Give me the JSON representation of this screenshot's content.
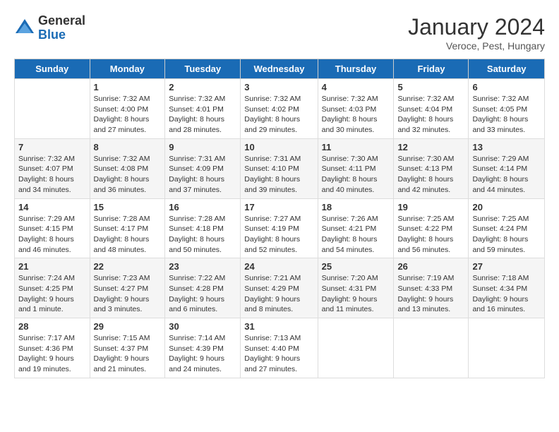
{
  "logo": {
    "general": "General",
    "blue": "Blue"
  },
  "title": "January 2024",
  "location": "Veroce, Pest, Hungary",
  "days_header": [
    "Sunday",
    "Monday",
    "Tuesday",
    "Wednesday",
    "Thursday",
    "Friday",
    "Saturday"
  ],
  "weeks": [
    [
      {
        "day": "",
        "info": ""
      },
      {
        "day": "1",
        "info": "Sunrise: 7:32 AM\nSunset: 4:00 PM\nDaylight: 8 hours\nand 27 minutes."
      },
      {
        "day": "2",
        "info": "Sunrise: 7:32 AM\nSunset: 4:01 PM\nDaylight: 8 hours\nand 28 minutes."
      },
      {
        "day": "3",
        "info": "Sunrise: 7:32 AM\nSunset: 4:02 PM\nDaylight: 8 hours\nand 29 minutes."
      },
      {
        "day": "4",
        "info": "Sunrise: 7:32 AM\nSunset: 4:03 PM\nDaylight: 8 hours\nand 30 minutes."
      },
      {
        "day": "5",
        "info": "Sunrise: 7:32 AM\nSunset: 4:04 PM\nDaylight: 8 hours\nand 32 minutes."
      },
      {
        "day": "6",
        "info": "Sunrise: 7:32 AM\nSunset: 4:05 PM\nDaylight: 8 hours\nand 33 minutes."
      }
    ],
    [
      {
        "day": "7",
        "info": "Sunrise: 7:32 AM\nSunset: 4:07 PM\nDaylight: 8 hours\nand 34 minutes."
      },
      {
        "day": "8",
        "info": "Sunrise: 7:32 AM\nSunset: 4:08 PM\nDaylight: 8 hours\nand 36 minutes."
      },
      {
        "day": "9",
        "info": "Sunrise: 7:31 AM\nSunset: 4:09 PM\nDaylight: 8 hours\nand 37 minutes."
      },
      {
        "day": "10",
        "info": "Sunrise: 7:31 AM\nSunset: 4:10 PM\nDaylight: 8 hours\nand 39 minutes."
      },
      {
        "day": "11",
        "info": "Sunrise: 7:30 AM\nSunset: 4:11 PM\nDaylight: 8 hours\nand 40 minutes."
      },
      {
        "day": "12",
        "info": "Sunrise: 7:30 AM\nSunset: 4:13 PM\nDaylight: 8 hours\nand 42 minutes."
      },
      {
        "day": "13",
        "info": "Sunrise: 7:29 AM\nSunset: 4:14 PM\nDaylight: 8 hours\nand 44 minutes."
      }
    ],
    [
      {
        "day": "14",
        "info": "Sunrise: 7:29 AM\nSunset: 4:15 PM\nDaylight: 8 hours\nand 46 minutes."
      },
      {
        "day": "15",
        "info": "Sunrise: 7:28 AM\nSunset: 4:17 PM\nDaylight: 8 hours\nand 48 minutes."
      },
      {
        "day": "16",
        "info": "Sunrise: 7:28 AM\nSunset: 4:18 PM\nDaylight: 8 hours\nand 50 minutes."
      },
      {
        "day": "17",
        "info": "Sunrise: 7:27 AM\nSunset: 4:19 PM\nDaylight: 8 hours\nand 52 minutes."
      },
      {
        "day": "18",
        "info": "Sunrise: 7:26 AM\nSunset: 4:21 PM\nDaylight: 8 hours\nand 54 minutes."
      },
      {
        "day": "19",
        "info": "Sunrise: 7:25 AM\nSunset: 4:22 PM\nDaylight: 8 hours\nand 56 minutes."
      },
      {
        "day": "20",
        "info": "Sunrise: 7:25 AM\nSunset: 4:24 PM\nDaylight: 8 hours\nand 59 minutes."
      }
    ],
    [
      {
        "day": "21",
        "info": "Sunrise: 7:24 AM\nSunset: 4:25 PM\nDaylight: 9 hours\nand 1 minute."
      },
      {
        "day": "22",
        "info": "Sunrise: 7:23 AM\nSunset: 4:27 PM\nDaylight: 9 hours\nand 3 minutes."
      },
      {
        "day": "23",
        "info": "Sunrise: 7:22 AM\nSunset: 4:28 PM\nDaylight: 9 hours\nand 6 minutes."
      },
      {
        "day": "24",
        "info": "Sunrise: 7:21 AM\nSunset: 4:29 PM\nDaylight: 9 hours\nand 8 minutes."
      },
      {
        "day": "25",
        "info": "Sunrise: 7:20 AM\nSunset: 4:31 PM\nDaylight: 9 hours\nand 11 minutes."
      },
      {
        "day": "26",
        "info": "Sunrise: 7:19 AM\nSunset: 4:33 PM\nDaylight: 9 hours\nand 13 minutes."
      },
      {
        "day": "27",
        "info": "Sunrise: 7:18 AM\nSunset: 4:34 PM\nDaylight: 9 hours\nand 16 minutes."
      }
    ],
    [
      {
        "day": "28",
        "info": "Sunrise: 7:17 AM\nSunset: 4:36 PM\nDaylight: 9 hours\nand 19 minutes."
      },
      {
        "day": "29",
        "info": "Sunrise: 7:15 AM\nSunset: 4:37 PM\nDaylight: 9 hours\nand 21 minutes."
      },
      {
        "day": "30",
        "info": "Sunrise: 7:14 AM\nSunset: 4:39 PM\nDaylight: 9 hours\nand 24 minutes."
      },
      {
        "day": "31",
        "info": "Sunrise: 7:13 AM\nSunset: 4:40 PM\nDaylight: 9 hours\nand 27 minutes."
      },
      {
        "day": "",
        "info": ""
      },
      {
        "day": "",
        "info": ""
      },
      {
        "day": "",
        "info": ""
      }
    ]
  ]
}
